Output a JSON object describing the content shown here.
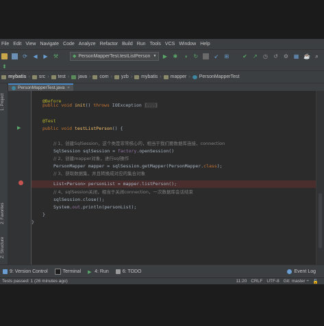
{
  "menu": [
    "File",
    "Edit",
    "View",
    "Navigate",
    "Code",
    "Analyze",
    "Refactor",
    "Build",
    "Run",
    "Tools",
    "VCS",
    "Window",
    "Help"
  ],
  "toolbar": {
    "run_config": "PersonMapperTest.testListPerson",
    "dropdown_arrow": "▼"
  },
  "breadcrumbs": [
    "mybatis",
    "src",
    "test",
    "java",
    "com",
    "yzb",
    "mybatis",
    "mapper",
    "PersonMapperTest"
  ],
  "editor_tab": {
    "title": "PersonMapperTest.java"
  },
  "left_tools": {
    "project": "1: Project",
    "favorites": "2: Favorites",
    "structure": "Z: Structure"
  },
  "code": {
    "l1": "@Before",
    "l2_a": "public void ",
    "l2_b": "init",
    "l2_c": "() ",
    "l2_d": "throws ",
    "l2_e": "IOException ",
    "l2_f": "{...}",
    "l3": "@Test",
    "l4_a": "public void ",
    "l4_b": "testListPerson",
    "l4_c": "() {",
    "l5": "// 1、创建SqlSession，这个类是非常核心的，相当于我们要数据库连接，connection",
    "l6_a": "SqlSession sqlSession = ",
    "l6_b": "factory",
    "l6_c": ".openSession()",
    "l7": "// 2、创建mapper对象，进行sql操作",
    "l8_a": "PersonMapper mapper = sqlSession.getMapper(PersonMapper.",
    "l8_b": "class",
    "l8_c": ");",
    "l9": "// 3、获取数据集，并且转换成对应的集合对象",
    "l10": "List<Person> personList = mapper.listPerson();",
    "l11": "// 4、sqlSession关闭，相当于关闭connection，一次数据库会话结束",
    "l12": "sqlSession.close();",
    "l13_a": "System.",
    "l13_b": "out",
    "l13_c": ".println(personList);",
    "l14": "}",
    "l15": "}"
  },
  "bottom_tabs": [
    "9: Version Control",
    "Terminal",
    "4: Run",
    "6: TODO"
  ],
  "event_log": "Event Log",
  "status": {
    "message": "Tests passed: 1 (26 minutes ago)",
    "position": "11:20",
    "line_sep": "CRLF",
    "encoding": "UTF-8",
    "git": "Git: master ÷"
  },
  "colors": {
    "breakpoint": "#c75450",
    "run_green": "#59a869",
    "accent_tab": "#4a88c7"
  }
}
